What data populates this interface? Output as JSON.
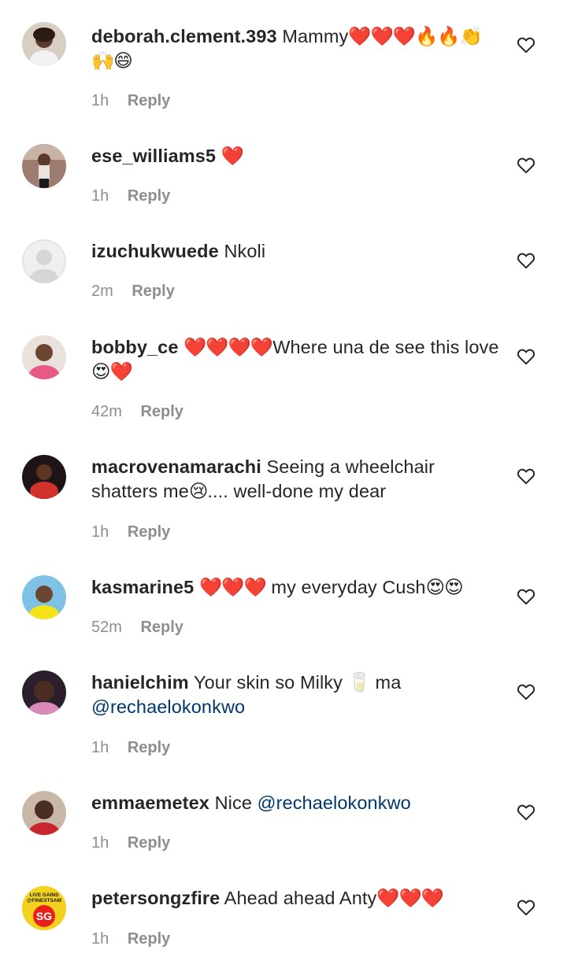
{
  "comments": [
    {
      "username": "deborah.clement.393",
      "text": "Mammy",
      "emoji": "❤️❤️❤️🔥🔥👏🙌😄",
      "mention": "",
      "time": "1h",
      "reply_label": "Reply",
      "avatar_color": "#c8b7a6"
    },
    {
      "username": "ese_williams5",
      "text": "",
      "emoji": "❤️",
      "mention": "",
      "time": "1h",
      "reply_label": "Reply",
      "avatar_color": "#a07a6a"
    },
    {
      "username": "izuchukwuede",
      "text": "Nkoli",
      "emoji": "",
      "mention": "",
      "time": "2m",
      "reply_label": "Reply",
      "avatar_color": "#dbdbdb"
    },
    {
      "username": "bobby_ce",
      "text": "Where una de see this love",
      "emoji_before": "❤️❤️❤️❤️",
      "emoji": "😍❤️",
      "mention": "",
      "time": "42m",
      "reply_label": "Reply",
      "avatar_color": "#8a6b5a"
    },
    {
      "username": "macrovenamarachi",
      "text": "Seeing a wheelchair shatters me",
      "emoji": "😢",
      "text_after": ".... well-done my dear",
      "mention": "",
      "time": "1h",
      "reply_label": "Reply",
      "avatar_color": "#c0302c"
    },
    {
      "username": "kasmarine5",
      "text": "my everyday Cush",
      "emoji_before": "❤️❤️❤️",
      "emoji": "😍😍",
      "mention": "",
      "time": "52m",
      "reply_label": "Reply",
      "avatar_color": "#e8d23a"
    },
    {
      "username": "hanielchim",
      "text": "Your skin so Milky",
      "emoji": "🥛",
      "text_after": "ma",
      "mention": "@rechaelokonkwo",
      "time": "1h",
      "reply_label": "Reply",
      "avatar_color": "#3b2a3a"
    },
    {
      "username": "emmaemetex",
      "text": "Nice",
      "emoji": "",
      "mention": "@rechaelokonkwo",
      "time": "1h",
      "reply_label": "Reply",
      "avatar_color": "#b23a3a"
    },
    {
      "username": "petersongzfire",
      "text": "Ahead ahead Anty",
      "emoji": "❤️❤️❤️",
      "mention": "",
      "time": "1h",
      "reply_label": "Reply",
      "avatar_color": "#f2d21e",
      "avatar_text": "LIVE GAINS @FINESTSAM",
      "avatar_badge": "SG"
    }
  ],
  "icons": {
    "like": "heart-outline-icon",
    "default_avatar": "user-silhouette-icon"
  },
  "colors": {
    "username": "#262626",
    "meta": "#8e8e8e",
    "mention": "#00376b",
    "heart_stroke": "#262626"
  }
}
